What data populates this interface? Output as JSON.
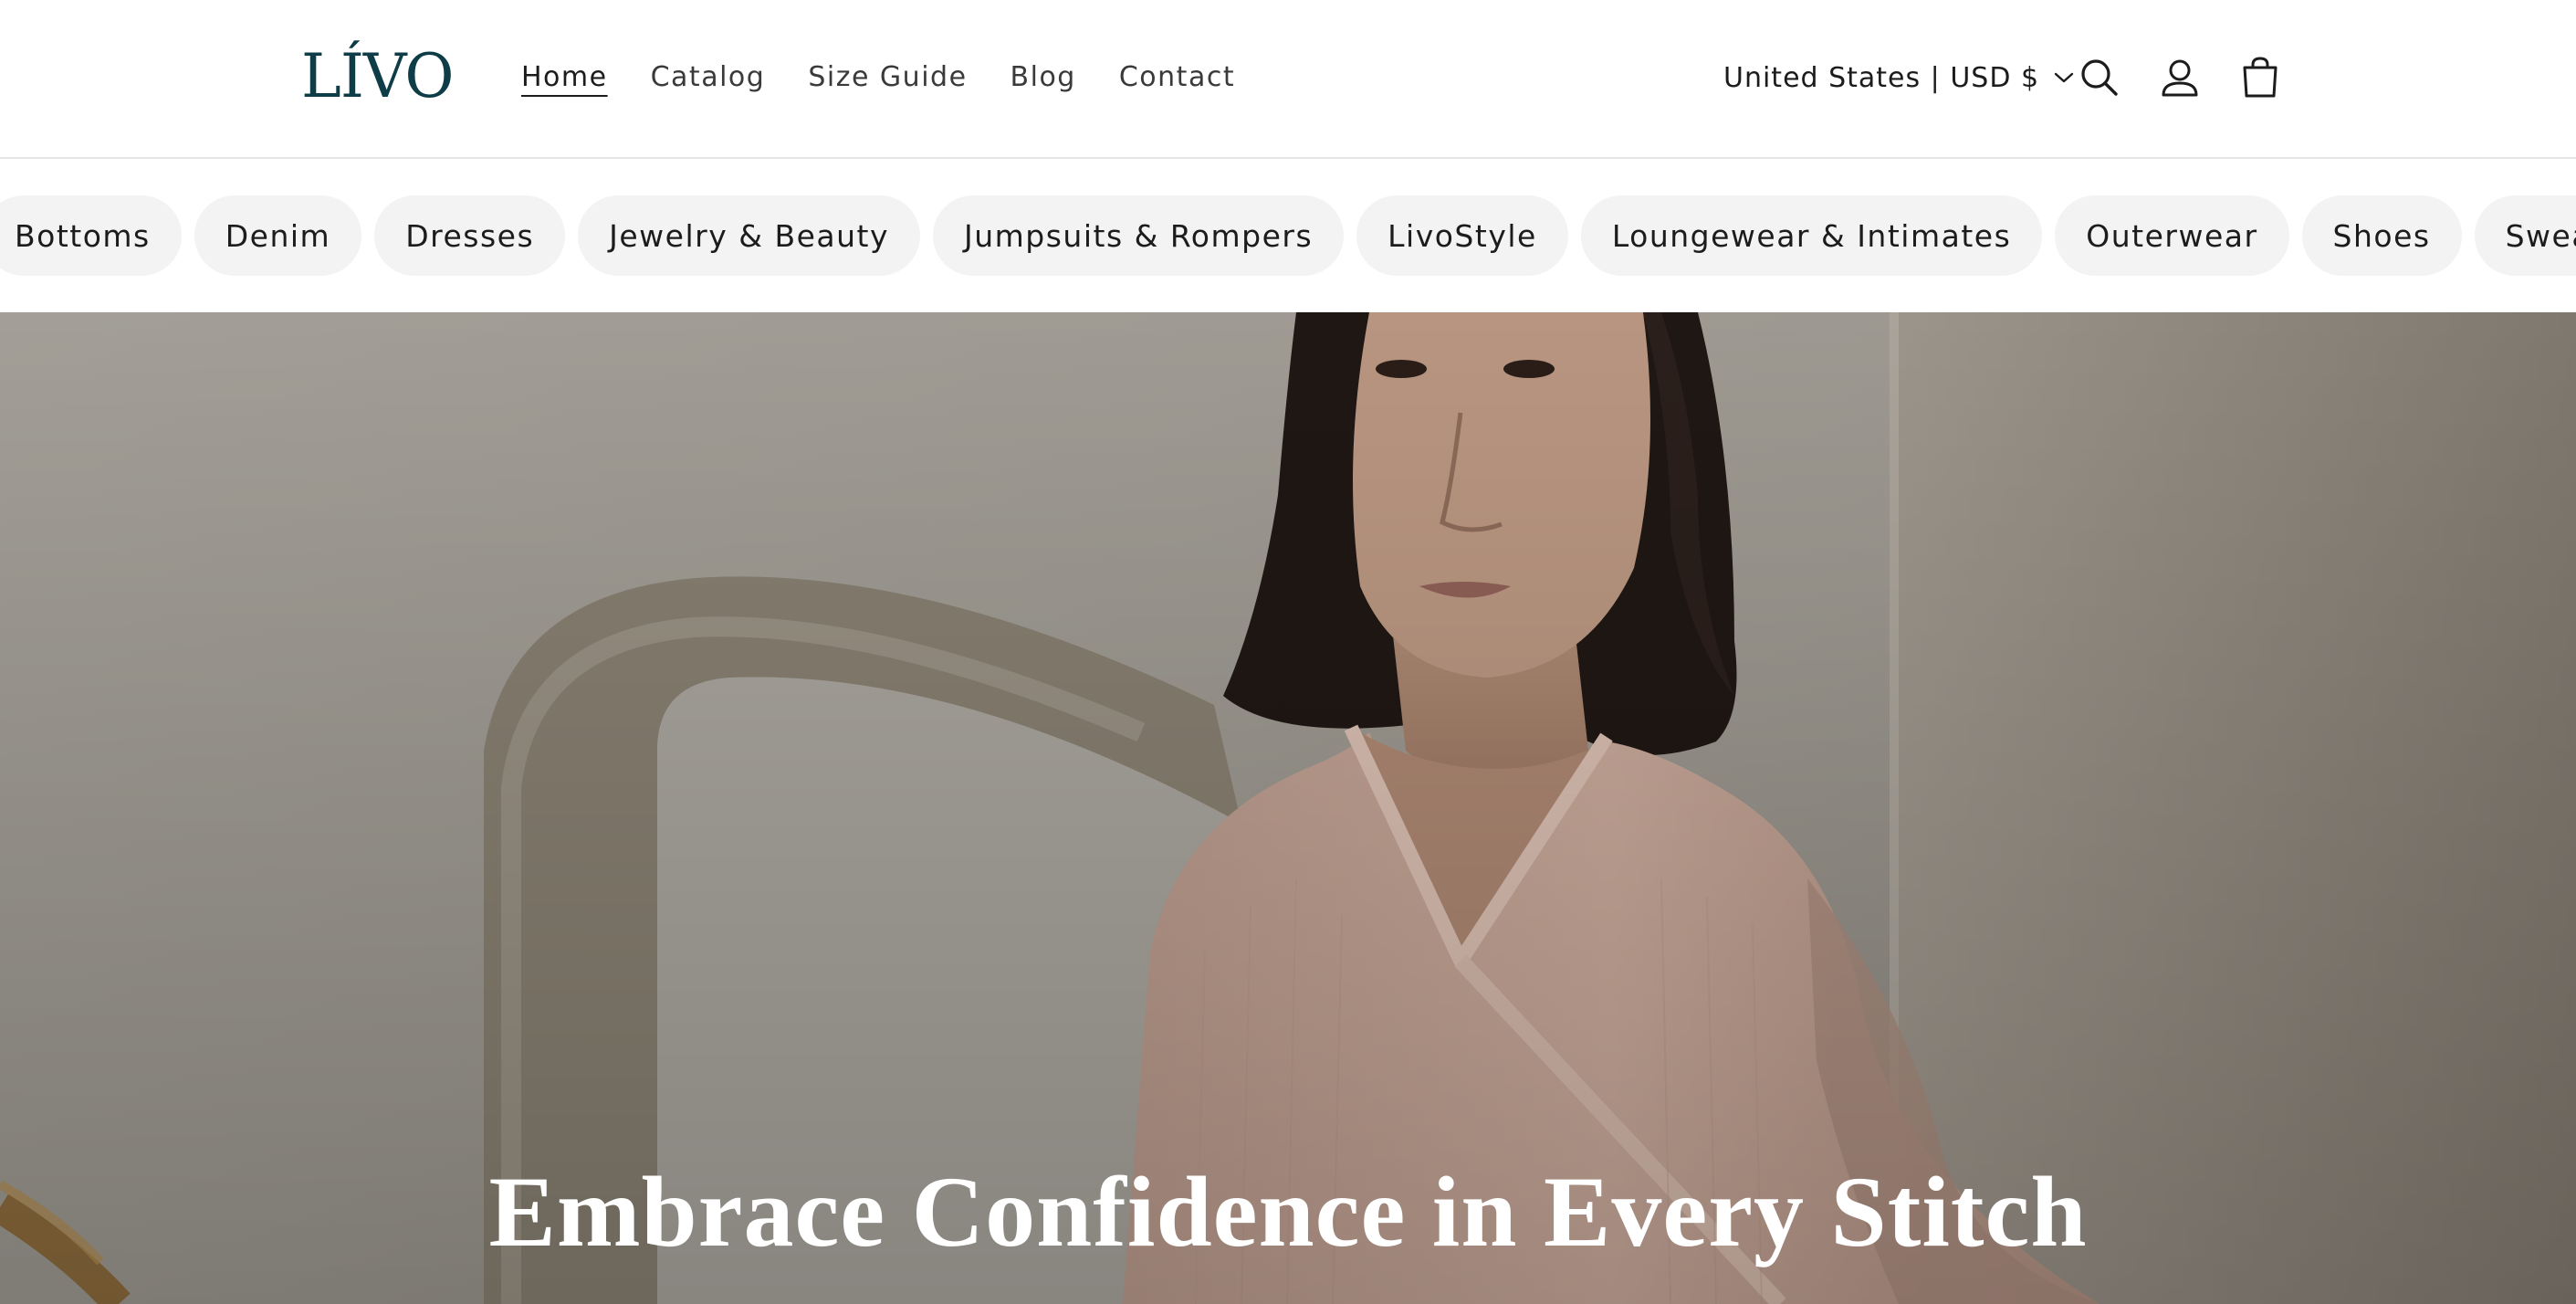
{
  "brand": {
    "logo_text": "LÍVO",
    "logo_color": "#0f3d47"
  },
  "header": {
    "nav": [
      {
        "label": "Home",
        "active": true
      },
      {
        "label": "Catalog",
        "active": false
      },
      {
        "label": "Size Guide",
        "active": false
      },
      {
        "label": "Blog",
        "active": false
      },
      {
        "label": "Contact",
        "active": false
      }
    ],
    "locale_label": "United States | USD $",
    "icons": [
      "chevron-down-icon",
      "search-icon",
      "account-icon",
      "cart-icon"
    ]
  },
  "categories": [
    "Bottoms",
    "Denim",
    "Dresses",
    "Jewelry & Beauty",
    "Jumpsuits & Rompers",
    "LivoStyle",
    "Loungewear & Intimates",
    "Outerwear",
    "Shoes",
    "Sweaters & Knitwear"
  ],
  "hero": {
    "title": "Embrace Confidence in Every Stitch",
    "image": "woman-in-pink-wrap-sweater-photo"
  },
  "colors": {
    "pill_bg": "#f3f3f3",
    "hero_overlay": "#9a968f",
    "sweater": "#c9a99a"
  }
}
